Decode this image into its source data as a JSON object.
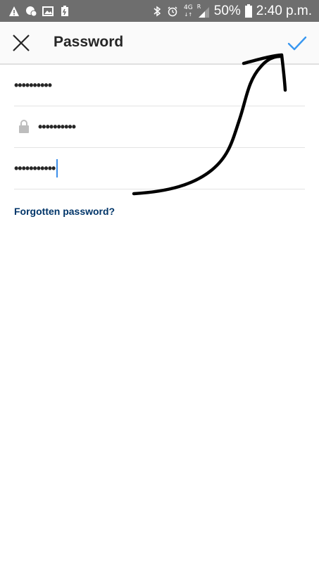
{
  "status_bar": {
    "network_label": "4G",
    "roaming_label": "R",
    "battery_percent": "50%",
    "time": "2:40 p.m."
  },
  "app_bar": {
    "title": "Password",
    "close_icon": "close-icon",
    "confirm_icon": "check-icon",
    "accent_color": "#3897f0"
  },
  "fields": {
    "current_password": "••••••••••",
    "new_password": "••••••••••",
    "confirm_password": "•••••••••••"
  },
  "links": {
    "forgot": "Forgotten password?"
  },
  "colors": {
    "status_bar_bg": "#6e6e6e",
    "link_color": "#003569",
    "caret_color": "#3b8eea"
  }
}
